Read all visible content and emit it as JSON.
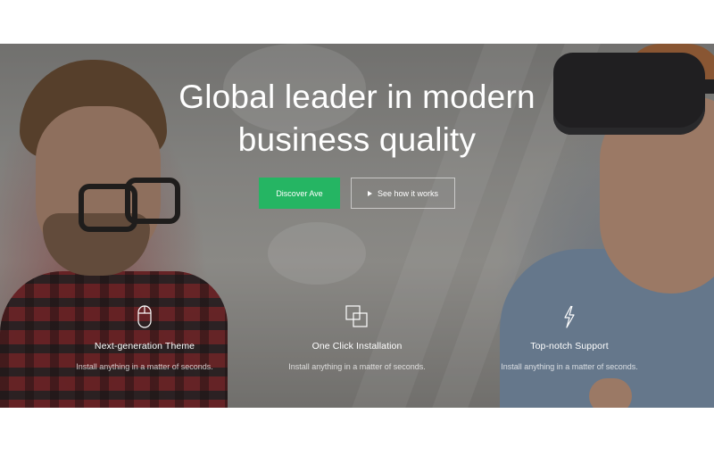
{
  "hero": {
    "headline_line1": "Global leader in modern",
    "headline_line2": "business quality",
    "primary_button": "Discover Ave",
    "secondary_button": "See how it works",
    "accent_color": "#25b563"
  },
  "features": [
    {
      "icon": "mouse-icon",
      "title": "Next-generation Theme",
      "text": "Install anything in a matter of seconds."
    },
    {
      "icon": "windows-icon",
      "title": "One Click Installation",
      "text": "Install anything in a matter of seconds."
    },
    {
      "icon": "lightning-icon",
      "title": "Top-notch Support",
      "text": "Install anything in a matter of seconds."
    }
  ]
}
